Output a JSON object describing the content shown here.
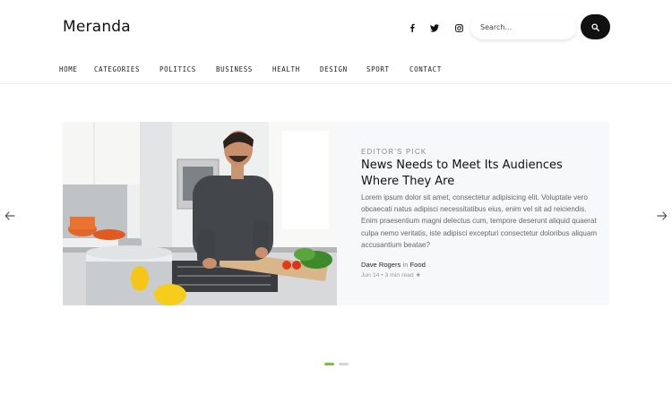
{
  "site": {
    "logo": "Meranda"
  },
  "header": {
    "social": [
      {
        "name": "facebook-icon"
      },
      {
        "name": "twitter-icon"
      },
      {
        "name": "instagram-icon"
      }
    ],
    "search": {
      "placeholder": "Search...",
      "value": ""
    },
    "search_button_icon": "search-icon"
  },
  "nav": {
    "items": [
      "HOME",
      "CATEGORIES",
      "POLITICS",
      "BUSINESS",
      "HEALTH",
      "DESIGN",
      "SPORT",
      "CONTACT"
    ]
  },
  "slider": {
    "prev_icon": "arrow-left-icon",
    "next_icon": "arrow-right-icon",
    "active_index": 0,
    "slide_count": 2,
    "colors": {
      "active_dot": "#7ac142",
      "inactive_dot": "#d5d5d5",
      "card_bg": "#f7f8f9"
    }
  },
  "feature": {
    "kicker": "EDITOR'S PICK",
    "title": "News Needs to Meet Its Audiences Where They Are",
    "excerpt": "Lorem ipsum dolor sit amet, consectetur adipisicing elit. Voluptate vero obcaecati natus adipisci necessitatibus eius, enim vel sit ad reiciendis. Enim praesentium magni delectus cum, tempore deserunt aliquid quaerat culpa nemo veritatis, iste adipisci excepturi consectetur doloribus aliquam accusantium beatae?",
    "author": "Dave Rogers",
    "in_label": "in",
    "category": "Food",
    "date": "Jun 14",
    "separator": "•",
    "read_time": "3 min read",
    "star": "★",
    "image_alt": "Man chopping vegetables in a kitchen"
  }
}
